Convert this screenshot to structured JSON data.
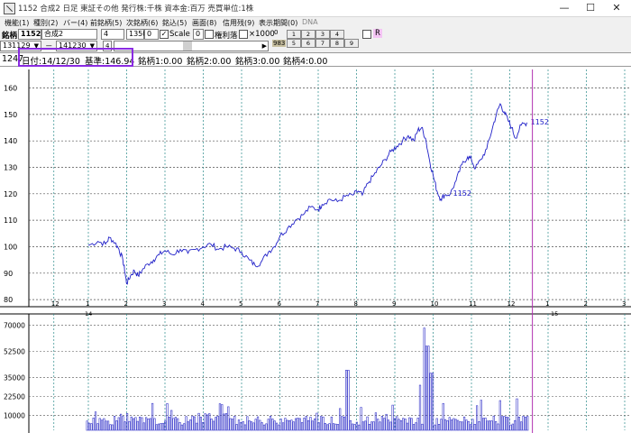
{
  "window": {
    "title": "1152 合成2 日足 東証その他 発行株:千株 資本金:百万 売買単位:1株",
    "controls": [
      "—",
      "☐",
      "✕"
    ]
  },
  "menu": [
    {
      "label": "機能(1)"
    },
    {
      "label": "種別(2)"
    },
    {
      "label": "バー(4)"
    },
    {
      "label": "前銘柄(5)"
    },
    {
      "label": "次銘柄(6)"
    },
    {
      "label": "銘込(5)"
    },
    {
      "label": "画面(8)"
    },
    {
      "label": "信用残(9)"
    },
    {
      "label": "表示期間(0)"
    },
    {
      "label": "DNA",
      "dim": true
    }
  ],
  "toolbar": {
    "symbol_label": "銘柄",
    "symbol_code": "1152",
    "symbol_name": "合成2",
    "field_a": "4",
    "field_b": "1350",
    "field_c": "0",
    "scale_label": "Scale",
    "zero_value": "0",
    "adjusted_label": "権利落",
    "x1000_label": "×1000",
    "small_zero": "0",
    "code_983": "983",
    "date_from": "131129",
    "dash": "－",
    "date_to": "141230",
    "step": "4",
    "r_label": "R",
    "num_row1": [
      "1",
      "2",
      "3",
      "4"
    ],
    "num_row2": [
      "5",
      "6",
      "7",
      "8",
      "9"
    ]
  },
  "info": {
    "count": "1247",
    "date": "日付:14/12/30",
    "base": "基準:146.94",
    "m1": "銘柄1:0.00",
    "m2": "銘柄2:0.00",
    "m3": "銘柄3:0.00",
    "m4": "銘柄4:0.00"
  },
  "colors": {
    "line": "#2020c8",
    "grid_h": "#505050",
    "grid_v": "#2a8a8a",
    "cursor": "#b030b0",
    "highlight": "#8a2be2",
    "volume": "#3030c8"
  },
  "chart_data": [
    {
      "type": "line",
      "series_label": "1152",
      "mid_label": "1152",
      "y_ticks": [
        80,
        90,
        100,
        110,
        120,
        130,
        140,
        150,
        160
      ],
      "ylim": [
        78,
        167
      ],
      "x_tick_labels": [
        "12",
        "1",
        "2",
        "3",
        "4",
        "5",
        "6",
        "7",
        "8",
        "9",
        "10",
        "11",
        "12",
        "1",
        "2",
        "3"
      ],
      "x_period_labels": [
        "14",
        "15"
      ],
      "x_months": [
        -0.9,
        0,
        1,
        2,
        3,
        4,
        5,
        6,
        7,
        8,
        9,
        10,
        11,
        12,
        13,
        14
      ],
      "points": [
        [
          0,
          100.5
        ],
        [
          0.25,
          102
        ],
        [
          0.45,
          101
        ],
        [
          0.55,
          103.5
        ],
        [
          0.7,
          101.5
        ],
        [
          0.8,
          99
        ],
        [
          0.9,
          95
        ],
        [
          0.96,
          90
        ],
        [
          1.0,
          86
        ],
        [
          1.1,
          89
        ],
        [
          1.2,
          91
        ],
        [
          1.3,
          89
        ],
        [
          1.4,
          91
        ],
        [
          1.55,
          93.5
        ],
        [
          1.7,
          95
        ],
        [
          1.85,
          97
        ],
        [
          2.0,
          98.5
        ],
        [
          2.2,
          97
        ],
        [
          2.4,
          99
        ],
        [
          2.6,
          97.5
        ],
        [
          2.8,
          99
        ],
        [
          3.0,
          100
        ],
        [
          3.2,
          101
        ],
        [
          3.4,
          99
        ],
        [
          3.6,
          100
        ],
        [
          3.8,
          99.5
        ],
        [
          4.0,
          98
        ],
        [
          4.2,
          95
        ],
        [
          4.35,
          93
        ],
        [
          4.5,
          94
        ],
        [
          4.7,
          98
        ],
        [
          4.85,
          100
        ],
        [
          5.0,
          104
        ],
        [
          5.2,
          107
        ],
        [
          5.4,
          110
        ],
        [
          5.6,
          112
        ],
        [
          5.8,
          115
        ],
        [
          6.0,
          114
        ],
        [
          6.1,
          116
        ],
        [
          6.3,
          118
        ],
        [
          6.5,
          117
        ],
        [
          6.7,
          119
        ],
        [
          6.9,
          119.5
        ],
        [
          7.05,
          121
        ],
        [
          7.15,
          119.5
        ],
        [
          7.3,
          124
        ],
        [
          7.45,
          127
        ],
        [
          7.6,
          130
        ],
        [
          7.75,
          133
        ],
        [
          7.9,
          136
        ],
        [
          8.05,
          138
        ],
        [
          8.2,
          140
        ],
        [
          8.35,
          142
        ],
        [
          8.5,
          140
        ],
        [
          8.6,
          144
        ],
        [
          8.7,
          145
        ],
        [
          8.8,
          141
        ],
        [
          8.9,
          133
        ],
        [
          9.0,
          127
        ],
        [
          9.1,
          121
        ],
        [
          9.2,
          118
        ],
        [
          9.3,
          119.5
        ],
        [
          9.45,
          120
        ],
        [
          9.6,
          125
        ],
        [
          9.75,
          131
        ],
        [
          9.9,
          134
        ],
        [
          10.0,
          133
        ],
        [
          10.1,
          129.5
        ],
        [
          10.25,
          133
        ],
        [
          10.4,
          137
        ],
        [
          10.55,
          145
        ],
        [
          10.65,
          150
        ],
        [
          10.75,
          154
        ],
        [
          10.85,
          151
        ],
        [
          10.95,
          148
        ],
        [
          11.05,
          145
        ],
        [
          11.15,
          141
        ],
        [
          11.3,
          146
        ],
        [
          11.45,
          146.9
        ]
      ]
    },
    {
      "type": "bar",
      "title": "volume",
      "y_ticks": [
        10000,
        22500,
        35000,
        52500,
        70000
      ],
      "ylim": [
        0,
        75000
      ],
      "peak_month": 8.75,
      "peak_value": 68000,
      "second_peak_month": 6.75,
      "second_peak_value": 40000
    }
  ]
}
